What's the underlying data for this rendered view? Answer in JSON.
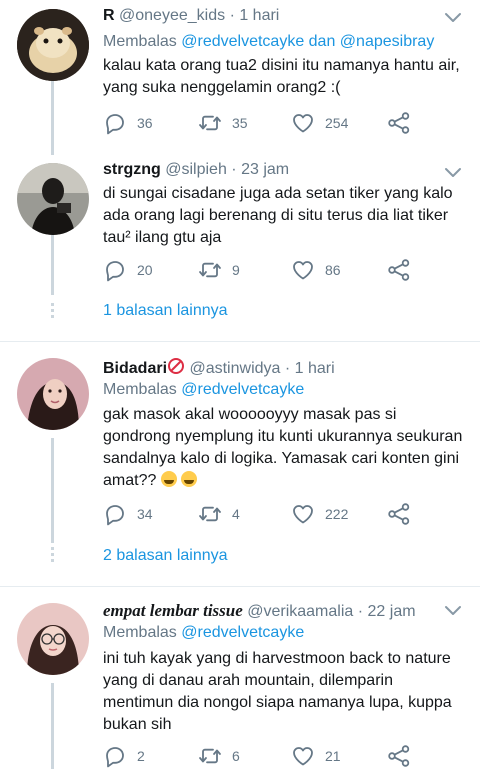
{
  "tweets": [
    {
      "name": "R",
      "handle": "@oneyee_kids",
      "time": "· 1 hari",
      "reply_prefix": "Membalas ",
      "reply_users": "@redvelvetcayke dan @napesibray",
      "text": "kalau kata orang tua2 disini itu namanya hantu air, yang suka nenggelamin orang2 :(",
      "replies": "36",
      "retweets": "35",
      "likes": "254"
    },
    {
      "name": "strgzng",
      "handle": "@silpieh",
      "time": "· 23 jam",
      "text": "di sungai cisadane juga ada setan tiker yang kalo ada orang lagi berenang di situ terus dia liat tiker tau² ilang gtu aja",
      "replies": "20",
      "retweets": "9",
      "likes": "86",
      "more": "1 balasan lainnya"
    },
    {
      "name": "Bidadari",
      "handle": "@astinwidya",
      "time": "· 1 hari",
      "reply_prefix": "Membalas ",
      "reply_users": "@redvelvetcayke",
      "text": "gak masok akal woooooyyy masak pas si gondrong nyemplung itu kunti ukurannya seukuran sandalnya kalo di logika. Yamasak cari konten gini amat??",
      "replies": "34",
      "retweets": "4",
      "likes": "222",
      "more": "2 balasan lainnya"
    },
    {
      "name": "empat lembar tissue",
      "handle": "@verikaamalia",
      "time": "· 22 jam",
      "reply_prefix": "Membalas ",
      "reply_users": "@redvelvetcayke",
      "text": "ini tuh kayak yang di harvestmoon back to nature yang di danau arah mountain, dilemparin mentimun dia nongol siapa namanya lupa, kuppa bukan sih",
      "replies": "2",
      "retweets": "6",
      "likes": "21"
    }
  ],
  "icons": {
    "reply": "reply-icon",
    "retweet": "retweet-icon",
    "like": "heart-icon",
    "share": "share-icon",
    "menu": "chevron-down-icon"
  },
  "colors": {
    "link": "#1b95e0",
    "secondary": "#657786",
    "thread": "#ccd6dd"
  }
}
